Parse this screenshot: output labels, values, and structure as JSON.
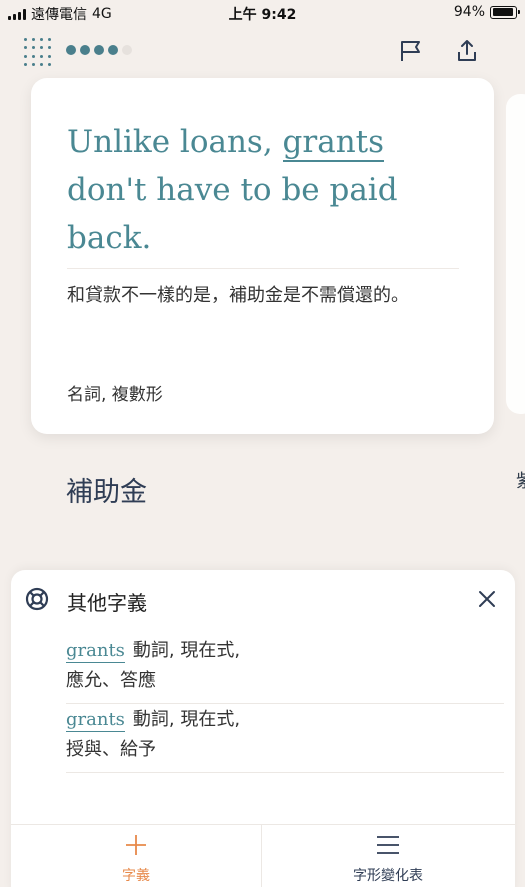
{
  "status_bar": {
    "carrier": "遠傳電信",
    "network": "4G",
    "time": "上午 9:42",
    "battery_text": "94%",
    "battery_level": 0.94
  },
  "toolbar": {
    "progress": {
      "total": 5,
      "filled": 4
    },
    "flag_icon": "flag-icon",
    "share_icon": "share-icon"
  },
  "card": {
    "sentence_before": "Unlike loans, ",
    "sentence_highlight": "grants",
    "sentence_after": " don't have to be paid back.",
    "translation": "和貸款不一樣的是，補助金是不需償還的。",
    "part_of_speech": "名詞, 複數形"
  },
  "peek_text": "紫",
  "meaning": "補助金",
  "sheet": {
    "title": "其他字義",
    "senses": [
      {
        "word": "grants",
        "grammar": "動詞, 現在式,",
        "definition": "應允、答應"
      },
      {
        "word": "grants",
        "grammar": "動詞, 現在式,",
        "definition": "授與、給予"
      }
    ]
  },
  "tabs": [
    {
      "label": "字義",
      "icon": "plus-icon",
      "active": true
    },
    {
      "label": "字形變化表",
      "icon": "menu-icon",
      "active": false
    }
  ],
  "colors": {
    "accent": "#4a8893",
    "active_tab": "#e7894a",
    "background": "#f4efeb",
    "heading": "#2f3d55"
  }
}
